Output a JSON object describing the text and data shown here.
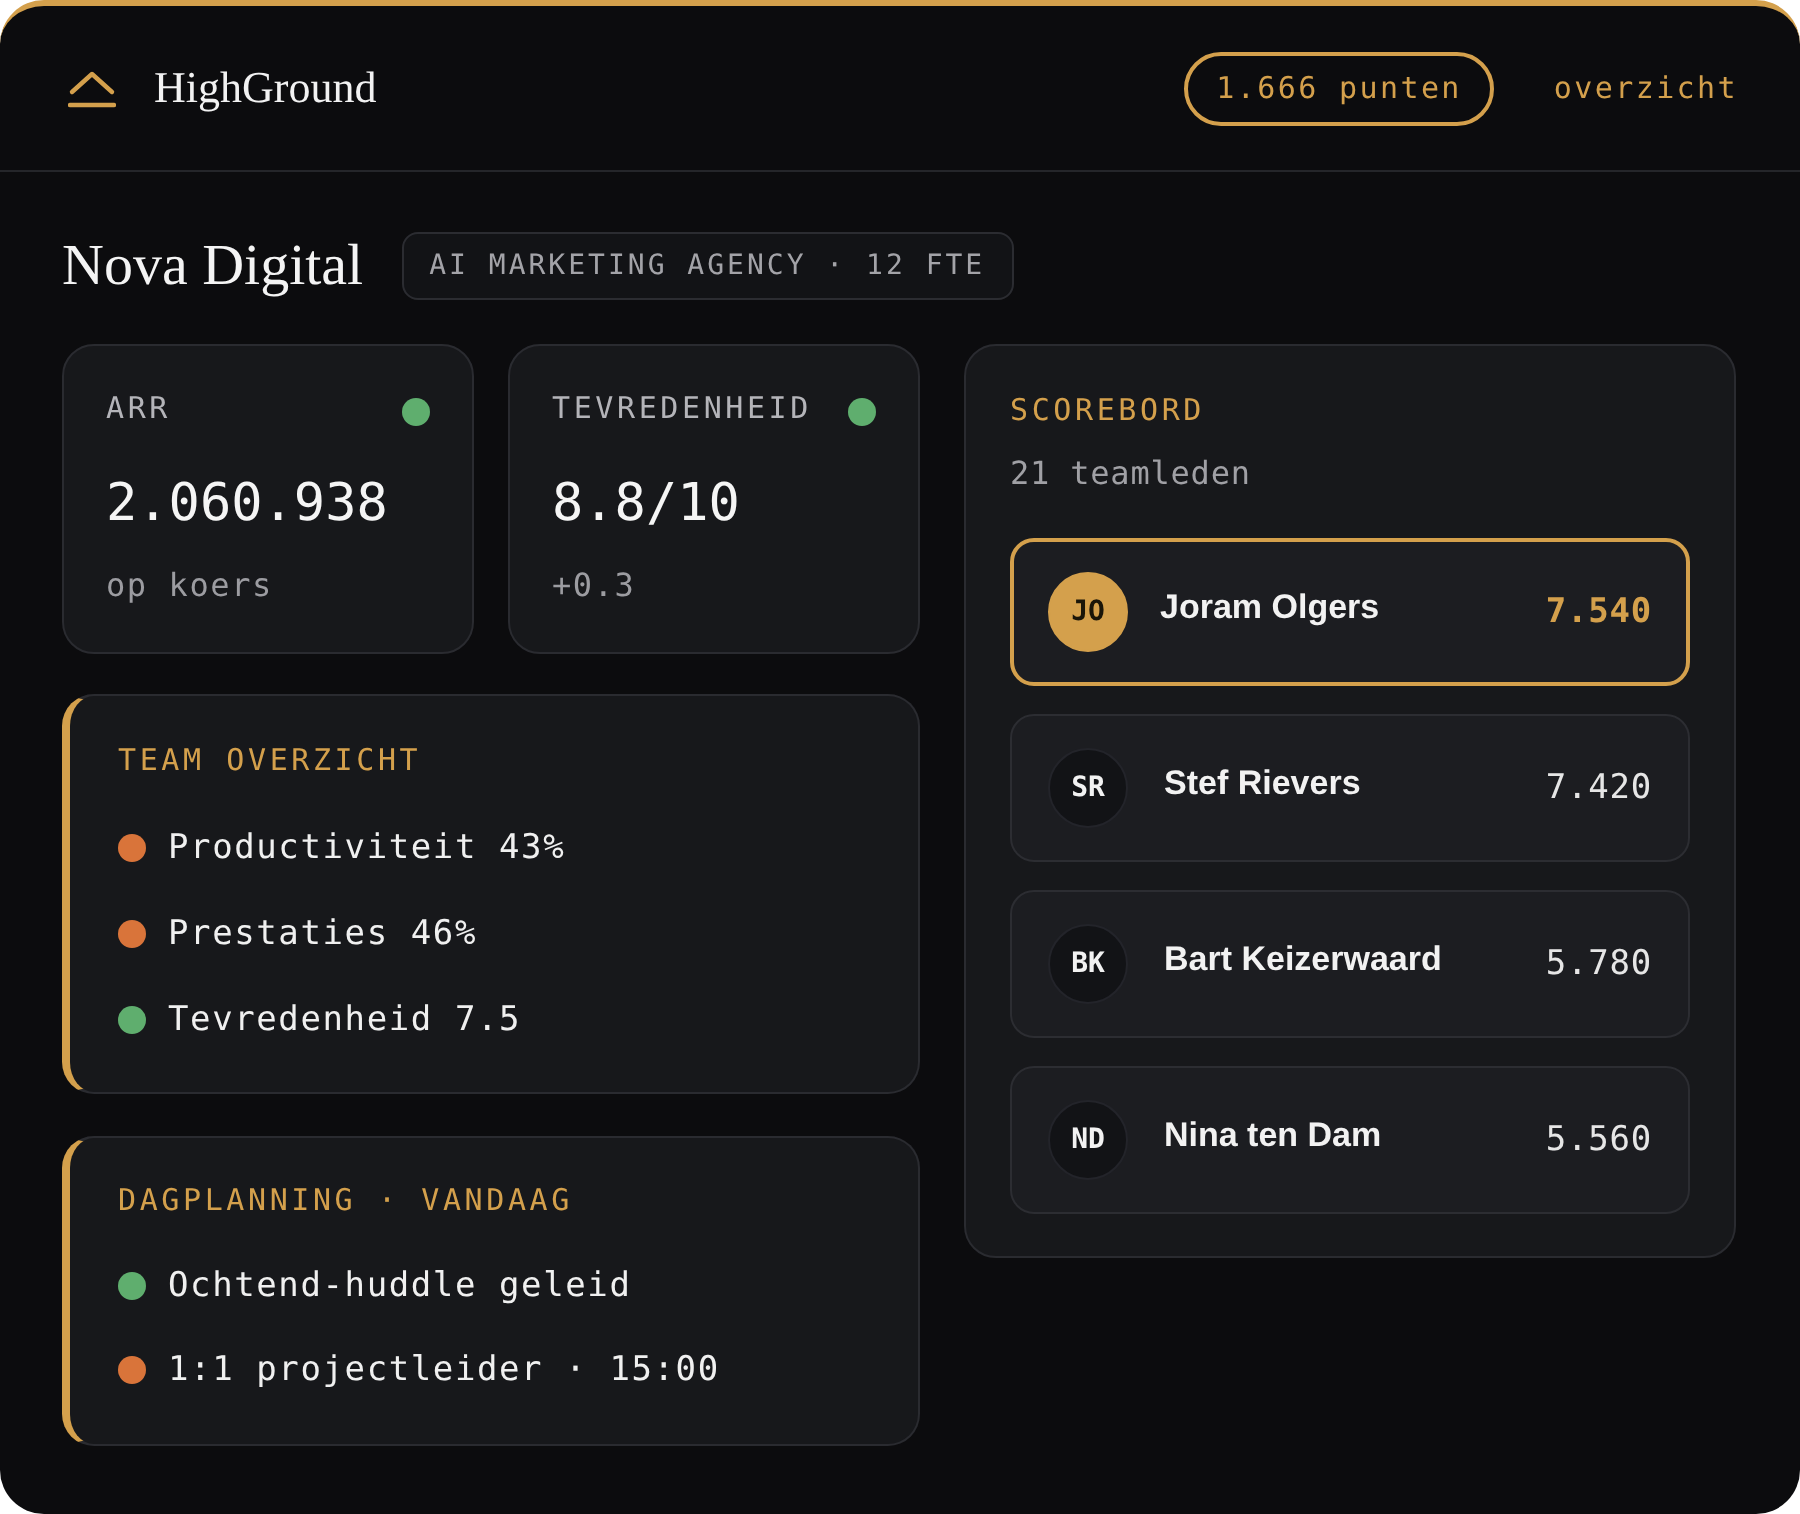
{
  "header": {
    "brand": "HighGround",
    "points": "1.666 punten",
    "link": "overzicht"
  },
  "company": {
    "name": "Nova Digital",
    "tag": "AI MARKETING AGENCY · 12 FTE"
  },
  "stats": [
    {
      "label": "ARR",
      "color": "#5fae6e",
      "value": "2.060.938",
      "note": "op koers"
    },
    {
      "label": "TEVREDENHEID",
      "color": "#5fae6e",
      "value": "8.8/10",
      "note": "+0.3"
    }
  ],
  "team_overview": {
    "title": "TEAM OVERZICHT",
    "items": [
      {
        "text": "Productiviteit 43%",
        "color": "#d9743a"
      },
      {
        "text": "Prestaties 46%",
        "color": "#d9743a"
      },
      {
        "text": "Tevredenheid 7.5",
        "color": "#5fae6e"
      }
    ]
  },
  "day_plan": {
    "title": "DAGPLANNING · VANDAAG",
    "items": [
      {
        "text": "Ochtend-huddle geleid",
        "color": "#5fae6e"
      },
      {
        "text": "1:1 projectleider · 15:00",
        "color": "#d9743a"
      }
    ]
  },
  "scoreboard": {
    "title": "SCOREBORD",
    "subtitle": "21 teamleden",
    "rows": [
      {
        "initials": "JO",
        "name": "Joram Olgers",
        "score": "7.540",
        "selected": true
      },
      {
        "initials": "SR",
        "name": "Stef Rievers",
        "score": "7.420",
        "selected": false
      },
      {
        "initials": "BK",
        "name": "Bart Keizerwaard",
        "score": "5.780",
        "selected": false
      },
      {
        "initials": "ND",
        "name": "Nina ten Dam",
        "score": "5.560",
        "selected": false
      }
    ]
  }
}
